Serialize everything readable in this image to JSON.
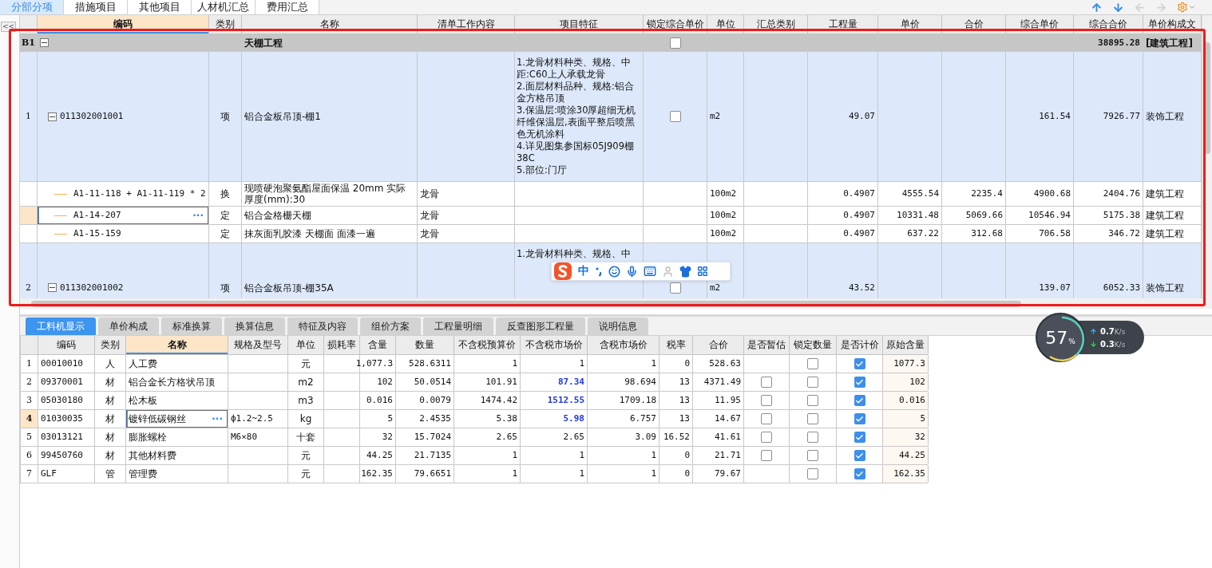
{
  "top_tabs": [
    {
      "label": "分部分项",
      "selected": true
    },
    {
      "label": "措施项目",
      "selected": false
    },
    {
      "label": "其他项目",
      "selected": false
    },
    {
      "label": "人材机汇总",
      "selected": false
    },
    {
      "label": "费用汇总",
      "selected": false
    }
  ],
  "side_toggle": "<<",
  "grid": {
    "columns": [
      {
        "label": "编码",
        "selected": true
      },
      {
        "label": "类别",
        "selected": false
      },
      {
        "label": "名称",
        "selected": false
      },
      {
        "label": "清单工作内容",
        "selected": false
      },
      {
        "label": "项目特征",
        "selected": false
      },
      {
        "label": "锁定综合单价",
        "selected": false
      },
      {
        "label": "单位",
        "selected": false
      },
      {
        "label": "汇总类别",
        "selected": false
      },
      {
        "label": "工程量",
        "selected": false
      },
      {
        "label": "单价",
        "selected": false
      },
      {
        "label": "合价",
        "selected": false
      },
      {
        "label": "综合单价",
        "selected": false
      },
      {
        "label": "综合合价",
        "selected": false
      },
      {
        "label": "单价构成文",
        "selected": false
      }
    ],
    "rows": [
      {
        "kind": "group",
        "number": "B1",
        "expanded": true,
        "name": "天棚工程",
        "locked": false,
        "comp_total": "38895.28",
        "composition": "[建筑工程]",
        "selected": false
      },
      {
        "kind": "item",
        "number": "1",
        "expanded": true,
        "code": "011302001001",
        "type": "项",
        "name": "铝合金板吊顶-棚1",
        "features": [
          "1.龙骨材料种类、规格、中",
          "距:C60上人承载龙骨",
          "2.面层材料品种、规格:铝合",
          "金方格吊顶",
          "3.保温层:喷涂30厚超细无机",
          "纤维保温层,表面平整后喷黑",
          "色无机涂料",
          "4.详见图集参国标05J909棚",
          "38C",
          "5.部位:门厅"
        ],
        "locked": false,
        "unit": "m2",
        "qty": "49.07",
        "comp_unit": "161.54",
        "comp_total": "7926.77",
        "composition": "装饰工程",
        "selected": false
      },
      {
        "kind": "sub",
        "code": "A1-11-118 + A1-11-119 * 2",
        "type": "换",
        "name": "现喷硬泡聚氨酯屋面保温 20mm  实际厚度(mm):30",
        "work": "龙骨",
        "unit": "100m2",
        "qty": "0.4907",
        "unit_price": "4555.54",
        "total": "2235.4",
        "comp_unit": "4900.68",
        "comp_total": "2404.76",
        "composition": "建筑工程",
        "selected": false
      },
      {
        "kind": "sub",
        "code": "A1-14-207",
        "type": "定",
        "name": "铝合金格栅天棚",
        "work": "龙骨",
        "unit": "100m2",
        "qty": "0.4907",
        "unit_price": "10331.48",
        "total": "5069.66",
        "comp_unit": "10546.94",
        "comp_total": "5175.38",
        "composition": "建筑工程",
        "selected": true,
        "more_button": "···"
      },
      {
        "kind": "sub",
        "code": "A1-15-159",
        "type": "定",
        "name": "抹灰面乳胶漆 天棚面 面漆一遍",
        "work": "龙骨",
        "unit": "100m2",
        "qty": "0.4907",
        "unit_price": "637.22",
        "total": "312.68",
        "comp_unit": "706.58",
        "comp_total": "346.72",
        "composition": "建筑工程",
        "selected": false
      },
      {
        "kind": "item",
        "number": "2",
        "expanded": true,
        "code": "011302001002",
        "type": "项",
        "name": "铝合金板吊顶-棚35A",
        "features": [
          "1.龙骨材料种类、规格、中"
        ],
        "locked": false,
        "unit": "m2",
        "qty": "43.52",
        "comp_unit": "139.07",
        "comp_total": "6052.33",
        "composition": "装饰工程",
        "selected": false
      }
    ]
  },
  "detail_tabs": [
    {
      "label": "工料机显示",
      "selected": true
    },
    {
      "label": "单价构成",
      "selected": false
    },
    {
      "label": "标准换算",
      "selected": false
    },
    {
      "label": "换算信息",
      "selected": false
    },
    {
      "label": "特征及内容",
      "selected": false
    },
    {
      "label": "组价方案",
      "selected": false
    },
    {
      "label": "工程量明细",
      "selected": false
    },
    {
      "label": "反查图形工程量",
      "selected": false
    },
    {
      "label": "说明信息",
      "selected": false
    }
  ],
  "detail": {
    "columns": [
      {
        "label": "编码",
        "selected": false
      },
      {
        "label": "类别",
        "selected": false
      },
      {
        "label": "名称",
        "selected": true
      },
      {
        "label": "规格及型号",
        "selected": false
      },
      {
        "label": "单位",
        "selected": false
      },
      {
        "label": "损耗率",
        "selected": false
      },
      {
        "label": "含量",
        "selected": false
      },
      {
        "label": "数量",
        "selected": false
      },
      {
        "label": "不含税预算价",
        "selected": false
      },
      {
        "label": "不含税市场价",
        "selected": false
      },
      {
        "label": "含税市场价",
        "selected": false
      },
      {
        "label": "税率",
        "selected": false
      },
      {
        "label": "合价",
        "selected": false
      },
      {
        "label": "是否暂估",
        "selected": false
      },
      {
        "label": "锁定数量",
        "selected": false
      },
      {
        "label": "是否计价",
        "selected": false
      },
      {
        "label": "原始含量",
        "selected": false
      }
    ],
    "rows": [
      {
        "number": "1",
        "code": "00010010",
        "type": "人",
        "name": "人工费",
        "unit": "元",
        "content": "1,077.3",
        "amount": "528.6311",
        "budget_price": "1",
        "market_price": "1",
        "market_changed": false,
        "tax_price": "1",
        "tax_rate": "0",
        "total": "528.63",
        "lock_qty": false,
        "priced": true,
        "original": "1077.3",
        "selected": false
      },
      {
        "number": "2",
        "code": "09370001",
        "type": "材",
        "name": "铝合金长方格状吊顶",
        "unit": "m2",
        "content": "102",
        "amount": "50.0514",
        "budget_price": "101.91",
        "market_price": "87.34",
        "market_changed": true,
        "tax_price": "98.694",
        "tax_rate": "13",
        "total": "4371.49",
        "estimate": false,
        "lock_qty": false,
        "priced": true,
        "original": "102",
        "selected": false
      },
      {
        "number": "3",
        "code": "05030180",
        "type": "材",
        "name": "松木板",
        "unit": "m3",
        "content": "0.016",
        "amount": "0.0079",
        "budget_price": "1474.42",
        "market_price": "1512.55",
        "market_changed": true,
        "tax_price": "1709.18",
        "tax_rate": "13",
        "total": "11.95",
        "estimate": false,
        "lock_qty": false,
        "priced": true,
        "original": "0.016",
        "selected": false
      },
      {
        "number": "4",
        "code": "01030035",
        "type": "材",
        "name": "镀锌低碳钢丝",
        "spec": "ф1.2~2.5",
        "unit": "kg",
        "content": "5",
        "amount": "2.4535",
        "budget_price": "5.38",
        "market_price": "5.98",
        "market_changed": true,
        "tax_price": "6.757",
        "tax_rate": "13",
        "total": "14.67",
        "estimate": false,
        "lock_qty": false,
        "priced": true,
        "original": "5",
        "selected": true,
        "more_button": "···"
      },
      {
        "number": "5",
        "code": "03013121",
        "type": "材",
        "name": "膨胀螺栓",
        "spec": "M6×80",
        "unit": "十套",
        "content": "32",
        "amount": "15.7024",
        "budget_price": "2.65",
        "market_price": "2.65",
        "market_changed": false,
        "tax_price": "3.09",
        "tax_rate": "16.52",
        "total": "41.61",
        "estimate": false,
        "lock_qty": false,
        "priced": true,
        "original": "32",
        "selected": false
      },
      {
        "number": "6",
        "code": "99450760",
        "type": "材",
        "name": "其他材料费",
        "unit": "元",
        "content": "44.25",
        "amount": "21.7135",
        "budget_price": "1",
        "market_price": "1",
        "market_changed": false,
        "tax_price": "1",
        "tax_rate": "0",
        "total": "21.71",
        "estimate": false,
        "lock_qty": false,
        "priced": true,
        "original": "44.25",
        "selected": false
      },
      {
        "number": "7",
        "code": "GLF",
        "type": "管",
        "name": "管理费",
        "unit": "元",
        "content": "162.35",
        "amount": "79.6651",
        "budget_price": "1",
        "market_price": "1",
        "market_changed": false,
        "tax_price": "1",
        "tax_rate": "0",
        "total": "79.67",
        "lock_qty": false,
        "priced": true,
        "original": "162.35",
        "selected": false
      }
    ]
  },
  "ime": {
    "mode": "中"
  },
  "speed": {
    "percent": "57",
    "percent_unit": "%",
    "up": "0.7",
    "up_unit": "K/s",
    "down": "0.3",
    "down_unit": "K/s"
  }
}
